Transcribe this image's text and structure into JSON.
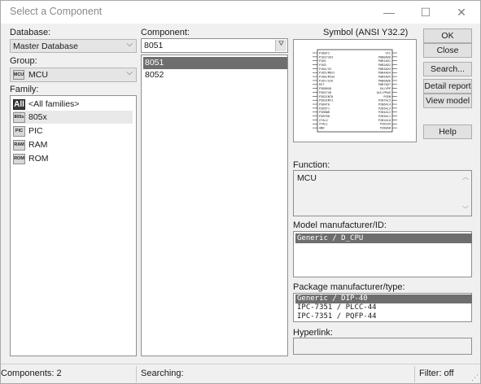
{
  "window": {
    "title": "Select a Component",
    "minimize_glyph": "—",
    "maximize_glyph": "☐",
    "close_glyph": "✕"
  },
  "database": {
    "label": "Database:",
    "value": "Master Database"
  },
  "group": {
    "label": "Group:",
    "value": "MCU",
    "icon_text": "MCU"
  },
  "family": {
    "label": "Family:",
    "items": [
      {
        "label": "<All families>",
        "icon_text": "All",
        "icon": "all-families-icon"
      },
      {
        "label": "805x",
        "icon_text": "805x",
        "icon": "chip-805x-icon"
      },
      {
        "label": "PIC",
        "icon_text": "PIC",
        "icon": "chip-pic-icon"
      },
      {
        "label": "RAM",
        "icon_text": "RAM",
        "icon": "chip-ram-icon"
      },
      {
        "label": "ROM",
        "icon_text": "ROM",
        "icon": "chip-rom-icon"
      }
    ],
    "highlighted_index": 1
  },
  "component": {
    "label": "Component:",
    "search_value": "8051",
    "filter_glyph": "⛛",
    "items": [
      "8051",
      "8052"
    ],
    "selected_index": 0
  },
  "symbol": {
    "label": "Symbol (ANSI Y32.2)",
    "pins_left": [
      "P1B0T2",
      "P1B1T2EX",
      "P1B2",
      "P1B3",
      "P1B4/SS",
      "P1B5/MOSI",
      "P1B6/MISO",
      "P1B7/SCK",
      "RST",
      "P3B0RXD",
      "P3B1TXD",
      "P3B2INT0",
      "P3B3INT1",
      "P3B4T0",
      "P3B5T1",
      "P3B6WR",
      "P3B7RD",
      "XTAL2",
      "XTAL1",
      "GND"
    ],
    "pins_right": [
      "VCC",
      "P0B0AD0",
      "P0B1AD1",
      "P0B2AD2",
      "P0B3AD3",
      "P0B4AD4",
      "P0B5AD5",
      "P0B6AD6",
      "P0B7AD7",
      "EA/VPP",
      "ALE/PROG",
      "PSEN",
      "P2B7A15",
      "P2B6A14",
      "P2B5A13",
      "P2B4A12",
      "P2B3A11",
      "P2B2A10",
      "P2B1A9",
      "P2B0A8"
    ]
  },
  "buttons": {
    "ok": "OK",
    "close": "Close",
    "search": "Search...",
    "detail_report": "Detail report",
    "view_model": "View model",
    "help": "Help"
  },
  "function": {
    "label": "Function:",
    "value": "MCU"
  },
  "model": {
    "label": "Model manufacturer/ID:",
    "items": [
      "Generic / D_CPU"
    ],
    "selected_index": 0
  },
  "package": {
    "label": "Package manufacturer/type:",
    "items": [
      "Generic / DIP-40",
      "IPC-7351 / PLCC-44",
      "IPC-7351 / PQFP-44"
    ],
    "selected_index": 0
  },
  "hyperlink": {
    "label": "Hyperlink:",
    "value": ""
  },
  "status": {
    "components": "Components: 2",
    "searching": "Searching:",
    "filter": "Filter: off"
  }
}
